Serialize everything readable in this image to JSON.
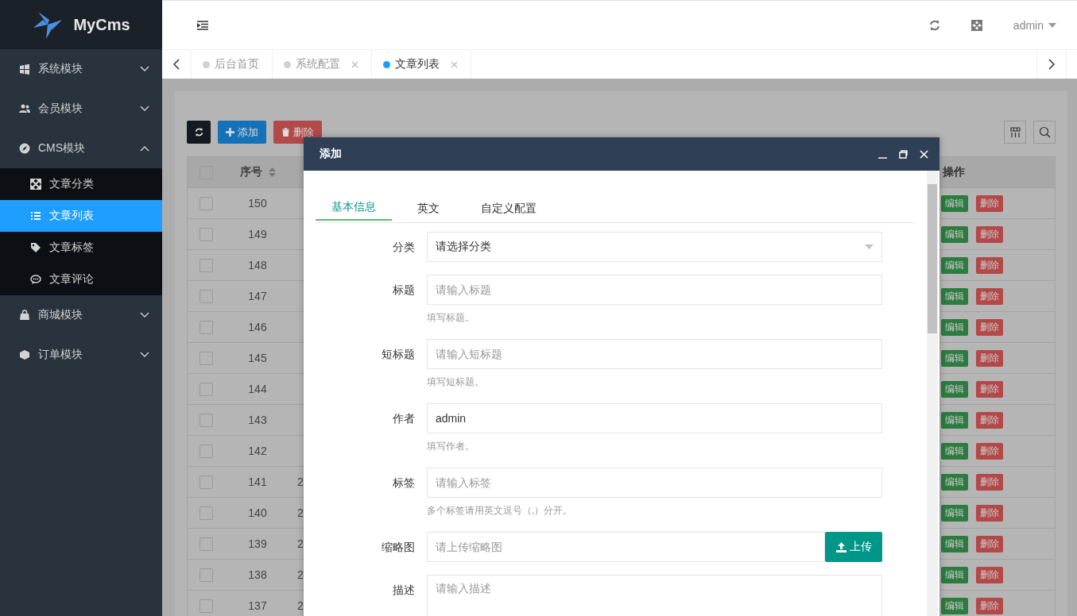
{
  "sidebar": {
    "logo": "MyCms",
    "items": [
      {
        "label": "系统模块",
        "expanded": false
      },
      {
        "label": "会员模块",
        "expanded": false
      },
      {
        "label": "CMS模块",
        "expanded": true,
        "children": [
          {
            "label": "文章分类",
            "selected": false
          },
          {
            "label": "文章列表",
            "selected": true
          },
          {
            "label": "文章标签",
            "selected": false
          },
          {
            "label": "文章评论",
            "selected": false
          }
        ]
      },
      {
        "label": "商城模块",
        "expanded": false
      },
      {
        "label": "订单模块",
        "expanded": false
      }
    ]
  },
  "header": {
    "user": "admin"
  },
  "tabs": [
    {
      "label": "后台首页",
      "selected": false,
      "closable": false
    },
    {
      "label": "系统配置",
      "selected": false,
      "closable": true
    },
    {
      "label": "文章列表",
      "selected": true,
      "closable": true
    }
  ],
  "toolbar": {
    "buttons": [
      {
        "kind": "refresh"
      },
      {
        "kind": "add",
        "label": "添加"
      },
      {
        "kind": "delete",
        "label": "删除"
      }
    ]
  },
  "table": {
    "columns": [
      "序号",
      "操作"
    ],
    "all_checked": false,
    "rows": [
      {
        "id": "150",
        "checked": false,
        "actions": [
          "编辑",
          "删除"
        ]
      },
      {
        "id": "149",
        "checked": false,
        "actions": [
          "编辑",
          "删除"
        ]
      },
      {
        "id": "148",
        "checked": false,
        "actions": [
          "编辑",
          "删除"
        ]
      },
      {
        "id": "147",
        "checked": false,
        "actions": [
          "编辑",
          "删除"
        ]
      },
      {
        "id": "146",
        "checked": false,
        "actions": [
          "编辑",
          "删除"
        ]
      },
      {
        "id": "145",
        "checked": false,
        "actions": [
          "编辑",
          "删除"
        ]
      },
      {
        "id": "144",
        "checked": false,
        "actions": [
          "编辑",
          "删除"
        ]
      },
      {
        "id": "143",
        "checked": false,
        "actions": [
          "编辑",
          "删除"
        ]
      },
      {
        "id": "142",
        "checked": false,
        "actions": [
          "编辑",
          "删除"
        ]
      },
      {
        "id": "141",
        "checked": false,
        "column_3": "2",
        "actions": [
          "编辑",
          "删除"
        ]
      },
      {
        "id": "140",
        "checked": false,
        "column_3": "2",
        "actions": [
          "编辑",
          "删除"
        ]
      },
      {
        "id": "139",
        "checked": false,
        "column_3": "2",
        "actions": [
          "编辑",
          "删除"
        ]
      },
      {
        "id": "138",
        "checked": false,
        "column_3": "2",
        "actions": [
          "编辑",
          "删除"
        ]
      },
      {
        "id": "137",
        "checked": false,
        "column_3": "2",
        "actions": [
          "编辑",
          "删除"
        ]
      }
    ]
  },
  "dialog": {
    "title": "添加",
    "tabs": [
      {
        "label": "基本信息",
        "selected": true
      },
      {
        "label": "英文",
        "selected": false
      },
      {
        "label": "自定义配置",
        "selected": false
      }
    ],
    "fields": [
      {
        "kind": "select",
        "label": "分类",
        "value": "请选择分类"
      },
      {
        "kind": "text",
        "label": "标题",
        "placeholder": "请输入标题",
        "hint": "填写标题。"
      },
      {
        "kind": "text",
        "label": "短标题",
        "placeholder": "请输入短标题",
        "hint": "填写短标题。"
      },
      {
        "kind": "text",
        "label": "作者",
        "value": "admin",
        "hint": "填写作者。"
      },
      {
        "kind": "text",
        "label": "标签",
        "placeholder": "请输入标签",
        "hint": "多个标签请用英文逗号（,）分开。"
      },
      {
        "kind": "upload",
        "label": "缩略图",
        "placeholder": "请上传缩略图",
        "button": "上传"
      },
      {
        "kind": "textarea",
        "label": "描述",
        "placeholder": "请输入描述"
      }
    ]
  }
}
